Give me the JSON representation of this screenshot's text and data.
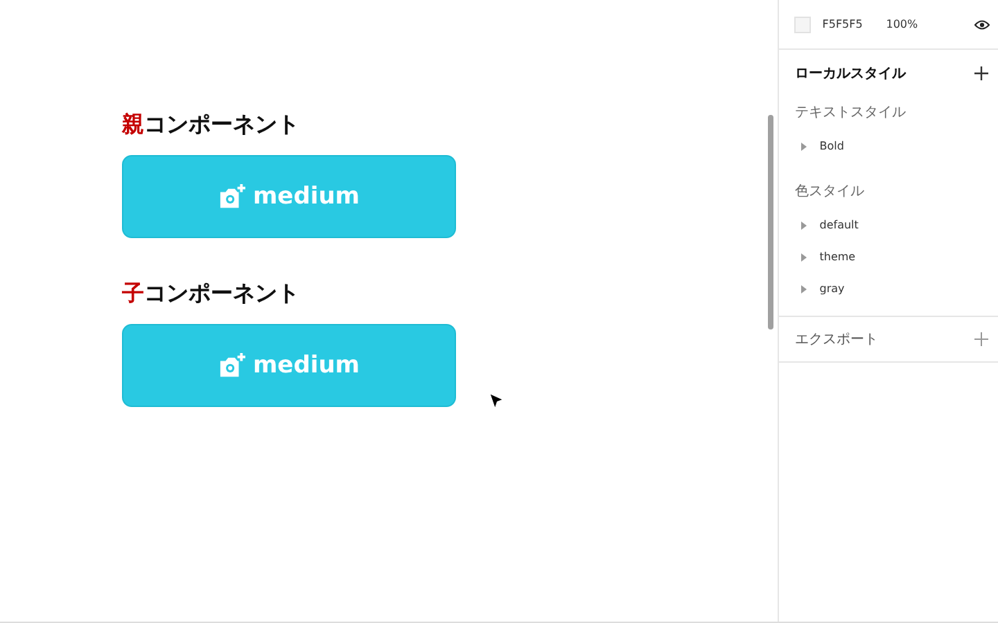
{
  "canvas": {
    "sections": [
      {
        "heading": {
          "mark": "親",
          "text": "コンポーネント"
        },
        "button": {
          "label": "medium"
        }
      },
      {
        "heading": {
          "mark": "子",
          "text": "コンポーネント"
        },
        "button": {
          "label": "medium"
        }
      }
    ]
  },
  "panel": {
    "fill": {
      "hex": "F5F5F5",
      "opacity": "100%"
    },
    "local_styles": {
      "title": "ローカルスタイル",
      "groups": [
        {
          "title": "テキストスタイル",
          "items": [
            "Bold"
          ]
        },
        {
          "title": "色スタイル",
          "items": [
            "default",
            "theme",
            "gray"
          ]
        }
      ]
    },
    "export": {
      "title": "エクスポート"
    }
  }
}
